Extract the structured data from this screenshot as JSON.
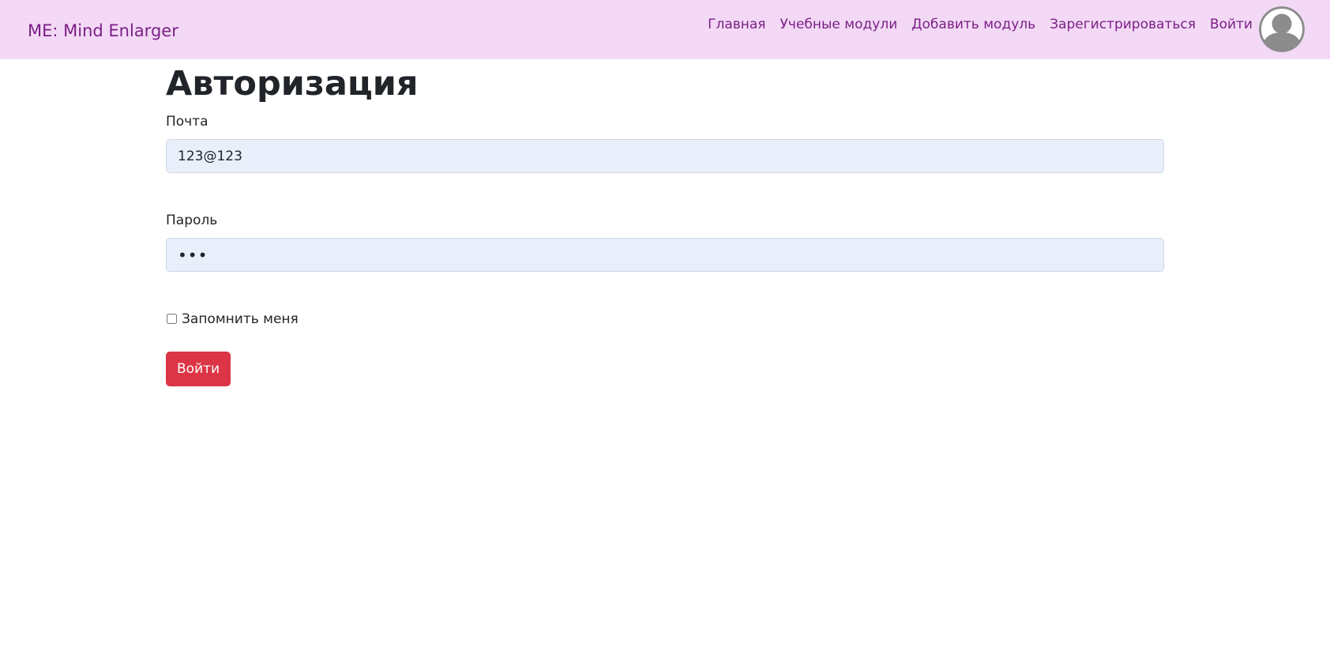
{
  "navbar": {
    "brand": "ME: Mind Enlarger",
    "links": [
      {
        "label": "Главная"
      },
      {
        "label": "Учебные модули"
      },
      {
        "label": "Добавить модуль"
      },
      {
        "label": "Зарегистрироваться"
      },
      {
        "label": "Войти"
      }
    ],
    "avatar_icon": "user-avatar-icon"
  },
  "main": {
    "title": "Авторизация",
    "email": {
      "label": "Почта",
      "value": "123@123"
    },
    "password": {
      "label": "Пароль",
      "value": "•••"
    },
    "remember": {
      "label": "Запомнить меня",
      "checked": false
    },
    "submit_label": "Войти"
  },
  "colors": {
    "navbar_bg": "#f3d9f6",
    "nav_text": "#7b1f86",
    "button_bg": "#dc3545",
    "input_bg": "#e8effb"
  }
}
